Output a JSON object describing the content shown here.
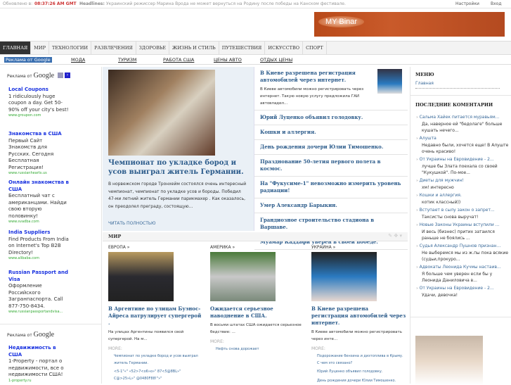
{
  "topbar": {
    "updated_label": "Обновлено в:",
    "time": "08:37:26 AM GMT",
    "headlines_label": "Headlines:",
    "headline": "Украинский режиссер Марина Врода не может вернуться на Родину после победы на Канском фестивале.",
    "settings": "Настройки",
    "login": "Вход"
  },
  "banner": {
    "logo": "MY Binar"
  },
  "nav": [
    "ГЛАВНАЯ",
    "МИР",
    "ТЕХНОЛОГИИ",
    "РАЗВЛЕЧЕНИЯ",
    "ЗДОРОВЬЕ",
    "ЖИЗНЬ И СТИЛЬ",
    "ПУТЕШЕСТВИЯ",
    "ИСКУССТВО",
    "СПОРТ"
  ],
  "subnav": {
    "google": "Реклама от Google",
    "items": [
      "МОДА",
      "ТУРИЗМ",
      "РАБОТА США",
      "ЦЕНЫ АВТО",
      "ОТДЫХ ЦЕНЫ"
    ]
  },
  "ads": {
    "header_prefix": "Реклама от",
    "header_brand": "Google",
    "items": [
      {
        "title": "Local Coupons",
        "text": "1 ridiculously huge coupon a day. Get 50-90% off your city's best!",
        "url": "www.groupon.com"
      },
      {
        "title": "Знакомства в США",
        "text": "Первый Сайт Знакомств для Русских. Сегодня Бесплатная Регистрация!",
        "url": "www.russianhearts.us"
      },
      {
        "title": "Онлайн знакомства в США",
        "text": "Бесплатный чат с американцами. Найди свою вторую половинку!",
        "url": "www.svadba.com"
      },
      {
        "title": "India Suppliers",
        "text": "Find Products From India on Internet's Top B2B Directory!",
        "url": "www.alibaba.com"
      },
      {
        "title": "Russian Passport and Visa",
        "text": "Оформление Российского Загранпаспорта. Call 877-750-8434.",
        "url": "www.russianpassportandvisa..."
      }
    ],
    "items2": [
      {
        "title": "Недвижимость в США",
        "text": "1-Property - портал о недвижимости, все о недвижимости США!",
        "url": "1-property.ru"
      }
    ]
  },
  "featured": {
    "title": "Чемпионат по укладке бород и усов выиграл житель Германии.",
    "text": "В норвежском городе Тронхейм состоялся очень интересный чемпионат, чемпионат по укладке усов и бороды. Победил 47-ми летний житель Германии парикмахер . Как оказалось, он преодолел преграду, состоящую...",
    "more": "ЧИТАТЬ ПОЛНОСТЬЮ"
  },
  "list": {
    "top": {
      "title": "В Киеве разрешена регистрация автомобилей через интернет.",
      "text": "В Киеве автомобили можно регистрировать через интернет. Такую новую услугу предложила ГАИ автовладел..."
    },
    "items": [
      "Юрий Луценко объявил голодовку.",
      "Кошки и аллергия.",
      "День рождения дочери Юлии Тимошенко.",
      "Празднование 50-летия первого полета в космос.",
      "На \"Фукусиме-1\" невозможно измерить уровень радиации!",
      "Умер Александр Барыкин.",
      "Грандиозное строительство стадиона в Варшаве.",
      "Муамар Каддафи уверен в своей победе."
    ]
  },
  "right": {
    "menu_title": "МЕНЮ",
    "menu_item": "Главная",
    "comments_title": "ПОСЛЕДНИЕ КОМЕНТАРИИ",
    "comments": [
      {
        "a": "Сальма Хайек питается муравьям...",
        "t": "Да, наверное ей \"бедолаге\" больше кушать нечего..."
      },
      {
        "a": "Алушта",
        "t": "Недавно были, хочется еще! В Алуште очень красиво!"
      },
      {
        "a": "От Украины на Евровидение - 2...",
        "t": "лучше бы Злата поехала со своей \"Кукушкой\". По-мое..."
      },
      {
        "a": "Диеты для мужчин!",
        "t": "хм! интересно"
      },
      {
        "a": "Кошки и аллергия.",
        "t": "котик классный))"
      },
      {
        "a": "Вступает в сылу закон о запрет...",
        "t": "Таксисты снова выручат!"
      },
      {
        "a": "Новые Законы Украины вступили ...",
        "t": "И весь (бизнес) притих затаился раньше не боялись ..."
      },
      {
        "a": "Судья Александр Пушнов признан...",
        "t": "Не выберемся мы из ж.пы пока всякие (судьи,прокуро..."
      },
      {
        "a": "Адвокаты Леонида Кучмы настаив...",
        "t": "Я больше чем уверен если бы у Леонида Даниловича в..."
      },
      {
        "a": "От Украины на Евровидение - 2...",
        "t": "Удачи, девочка!"
      }
    ]
  },
  "mir": {
    "title": "МИР",
    "cols": [
      {
        "h": "ЕВРОПА »",
        "title": "В Аргентине по улицам Буэнос-Айреса патрулирует супергерой .",
        "text": "На улицах Аргентины появился свой супергерой. На м...",
        "more": "MORE:",
        "links": [
          "Чемпионат по укладке бород и усов выиграл житель Германии.",
          "<5-1\"«\" «52>7<o6»o»\" 87<5@8BL»\" C@>25»L»\" @0480F88!\"»\""
        ]
      },
      {
        "h": "АМЕРИКА »",
        "title": "Ожидается серьезное наводнение в США.",
        "text": "В восьми штатах США ожидается серьезное бедствие: ...",
        "more": "MORE:",
        "links": [
          "Нефть снова дорожает"
        ]
      },
      {
        "h": "УКРАИНА »",
        "title": "В Киеве разрешена регистрация автомобилей через интернет.",
        "text": "В Киеве автомобили можно регистрировать через инте...",
        "more": "MORE:",
        "links": [
          "Подорожание бензина и дизтоплива в Крыму. С чем это связано?",
          "Юрий Луценко объявил голодовку.",
          "День рождения дочери Юлии Тимошенко."
        ]
      }
    ]
  }
}
